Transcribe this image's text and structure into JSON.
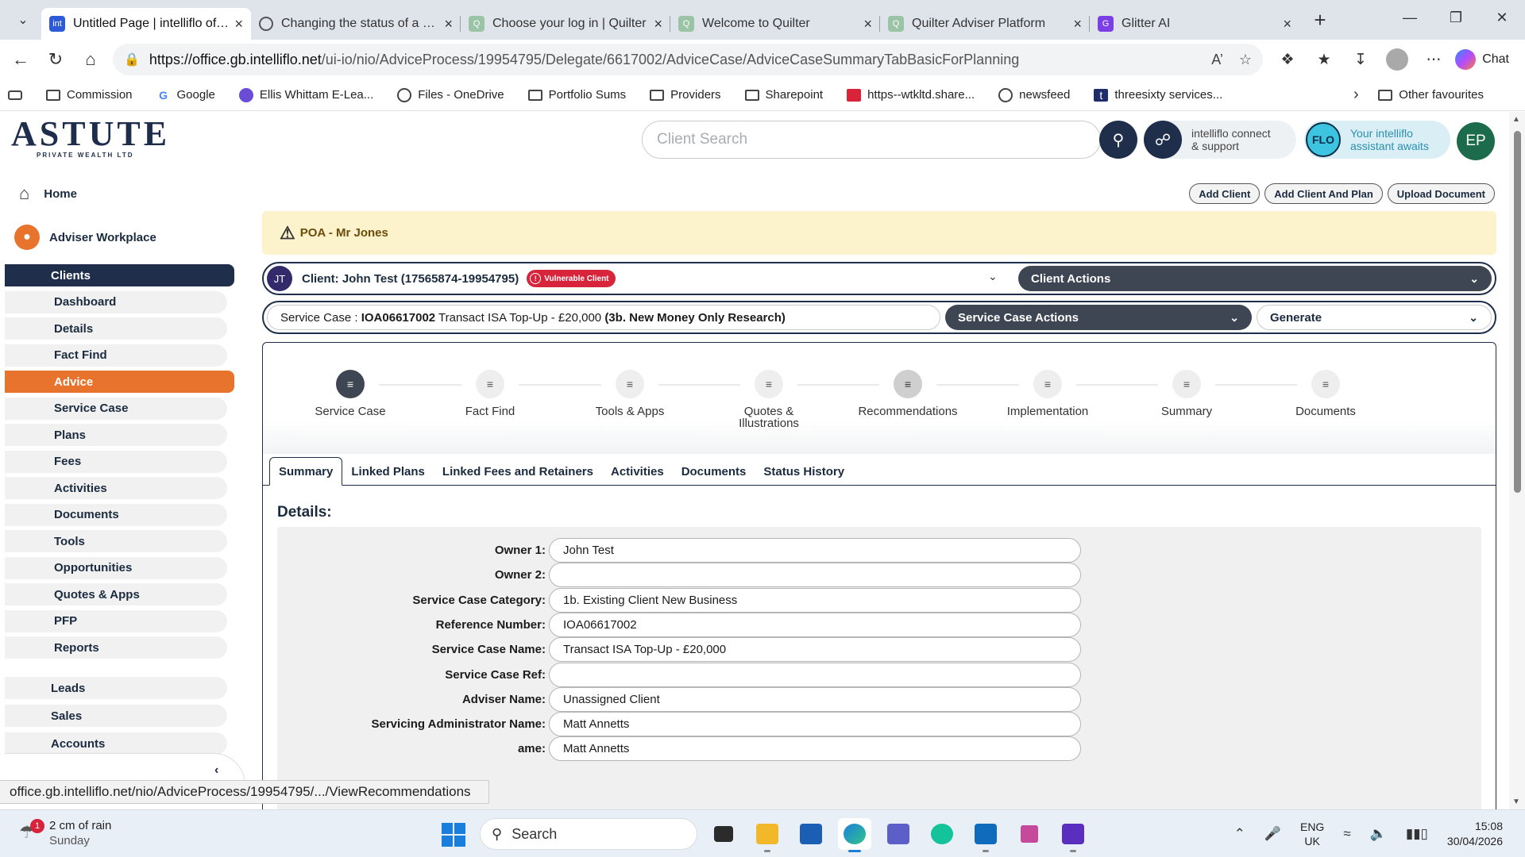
{
  "browser": {
    "tabs": [
      {
        "title": "Untitled Page | intelliflo office",
        "favicon": "int",
        "favicon_color": "#2d5bd6",
        "active": true
      },
      {
        "title": "Changing the status of a plan",
        "favicon": "globe",
        "favicon_color": "#555555",
        "active": false
      },
      {
        "title": "Choose your log in | Quilter",
        "favicon": "Q",
        "favicon_color": "#9bc4a6",
        "active": false
      },
      {
        "title": "Welcome to Quilter",
        "favicon": "Q",
        "favicon_color": "#9bc4a6",
        "active": false
      },
      {
        "title": "Quilter Adviser Platform",
        "favicon": "Q",
        "favicon_color": "#9bc4a6",
        "active": false
      },
      {
        "title": "Glitter AI",
        "favicon": "G",
        "favicon_color": "#7b3fe4",
        "active": false
      }
    ],
    "url_host": "https://office.gb.intelliflo.net",
    "url_path": "/ui-io/nio/AdviceProcess/19954795/Delegate/6617002/AdviceCase/AdviceCaseSummaryTabBasicForPlanning",
    "copilot_label": "Chat",
    "bookmarks": [
      {
        "label": "Commission",
        "icon": "folder-icon"
      },
      {
        "label": "Google",
        "icon": "google-icon"
      },
      {
        "label": "Ellis Whittam E-Lea...",
        "icon": "elearning-icon"
      },
      {
        "label": "Files - OneDrive",
        "icon": "globe-icon"
      },
      {
        "label": "Portfolio Sums",
        "icon": "folder-icon"
      },
      {
        "label": "Providers",
        "icon": "folder-icon"
      },
      {
        "label": "Sharepoint",
        "icon": "folder-icon"
      },
      {
        "label": "https--wtkltd.share...",
        "icon": "pdf-icon"
      },
      {
        "label": "newsfeed",
        "icon": "globe-icon"
      },
      {
        "label": "threesixty services...",
        "icon": "threesixty-icon"
      }
    ],
    "other_favourites": "Other favourites"
  },
  "header": {
    "logo_text": "ASTUTE",
    "logo_sub": "PRIVATE WEALTH LTD",
    "search_placeholder": "Client Search",
    "connect_line1": "intelliflo connect",
    "connect_line2": "& support",
    "flo_badge": "FLO",
    "flo_line1": "Your intelliflo",
    "flo_line2": "assistant awaits",
    "user_initials": "EP",
    "actions": [
      "Add Client",
      "Add Client And Plan",
      "Upload Document"
    ]
  },
  "sidebar": {
    "home": "Home",
    "workplace": "Adviser Workplace",
    "items": [
      "Clients",
      "Dashboard",
      "Details",
      "Fact Find",
      "Advice",
      "Service Case",
      "Plans",
      "Fees",
      "Activities",
      "Documents",
      "Tools",
      "Opportunities",
      "Quotes & Apps",
      "PFP",
      "Reports"
    ],
    "group": [
      "Leads",
      "Sales",
      "Accounts"
    ]
  },
  "alert": {
    "text": "POA - Mr Jones"
  },
  "client": {
    "initials": "JT",
    "name": "Client: John Test (17565874-19954795)",
    "vulnerable_label": "Vulnerable Client",
    "actions_label": "Client Actions"
  },
  "service_case": {
    "prefix": "Service Case : ",
    "code": "IOA06617002",
    "description": " Transact ISA Top-Up - £20,000 ",
    "research": "(3b. New Money Only Research)",
    "actions_label": "Service Case Actions",
    "generate_label": "Generate"
  },
  "steps": [
    {
      "line1": "Service Case",
      "line2": "",
      "state": "active"
    },
    {
      "line1": "Fact Find",
      "line2": "",
      "state": "default"
    },
    {
      "line1": "Tools & Apps",
      "line2": "",
      "state": "default"
    },
    {
      "line1": "Quotes &",
      "line2": "Illustrations",
      "state": "default"
    },
    {
      "line1": "Recommendations",
      "line2": "",
      "state": "visited"
    },
    {
      "line1": "Implementation",
      "line2": "",
      "state": "default"
    },
    {
      "line1": "Summary",
      "line2": "",
      "state": "default"
    },
    {
      "line1": "Documents",
      "line2": "",
      "state": "default"
    }
  ],
  "subtabs": [
    "Summary",
    "Linked Plans",
    "Linked Fees and Retainers",
    "Activities",
    "Documents",
    "Status History"
  ],
  "details": {
    "title": "Details:",
    "fields": [
      {
        "label": "Owner 1:",
        "value": "John Test"
      },
      {
        "label": "Owner 2:",
        "value": ""
      },
      {
        "label": "Service Case Category:",
        "value": "1b. Existing Client New Business"
      },
      {
        "label": "Reference Number:",
        "value": "IOA06617002"
      },
      {
        "label": "Service Case Name:",
        "value": "Transact ISA Top-Up - £20,000"
      },
      {
        "label": "Service Case Ref:",
        "value": ""
      },
      {
        "label": "Adviser Name:",
        "value": "Unassigned Client"
      },
      {
        "label": "Servicing Administrator Name:",
        "value": "Matt Annetts"
      },
      {
        "label": "ame:",
        "value": "Matt Annetts"
      }
    ]
  },
  "status_url": "office.gb.intelliflo.net/nio/AdviceProcess/19954795/.../ViewRecommendations",
  "taskbar": {
    "weather_badge": "1",
    "weather_line1": "2 cm of rain",
    "weather_line2": "Sunday",
    "search_label": "Search",
    "lang_line1": "ENG",
    "lang_line2": "UK",
    "time": "15:08",
    "date": "30/04/2026"
  }
}
